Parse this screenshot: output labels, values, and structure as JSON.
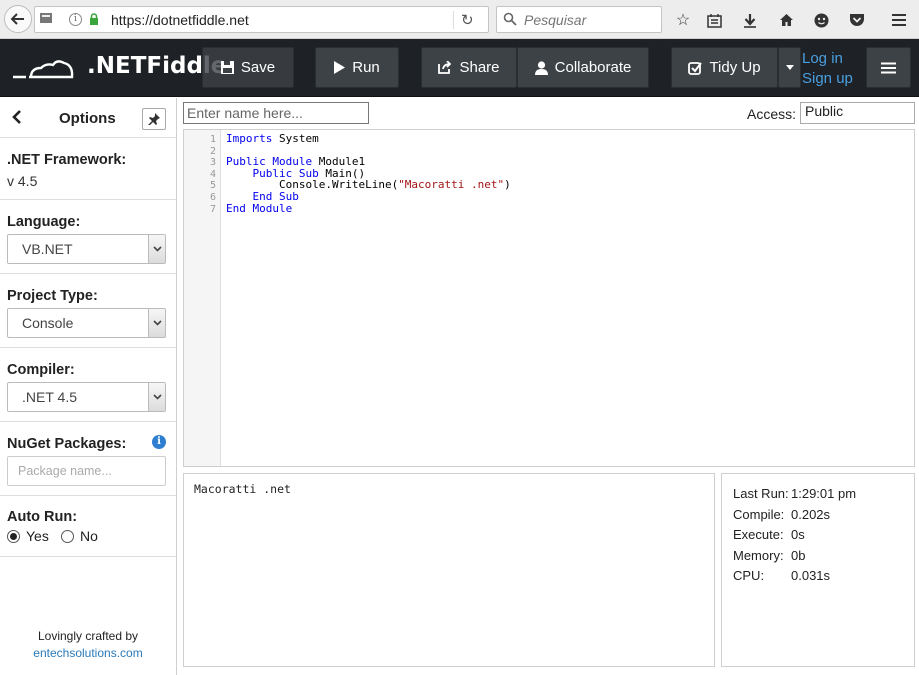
{
  "browser": {
    "url": "https://dotnetfiddle.net",
    "search_placeholder": "Pesquisar"
  },
  "header": {
    "logo_text": ".NETFiddle",
    "buttons": {
      "save": "Save",
      "run": "Run",
      "share": "Share",
      "collaborate": "Collaborate",
      "tidy_up": "Tidy Up"
    },
    "login": "Log in",
    "signup": "Sign up"
  },
  "sidebar": {
    "title": "Options",
    "framework_label": ".NET Framework:",
    "framework_value": "v 4.5",
    "language_label": "Language:",
    "language_value": "VB.NET",
    "project_type_label": "Project Type:",
    "project_type_value": "Console",
    "compiler_label": "Compiler:",
    "compiler_value": ".NET 4.5",
    "nuget_label": "NuGet Packages:",
    "nuget_placeholder": "Package name...",
    "autorun_label": "Auto Run:",
    "autorun_yes": "Yes",
    "autorun_no": "No",
    "credit_text": "Lovingly crafted by",
    "credit_link": "entechsolutions.com"
  },
  "main": {
    "name_placeholder": "Enter name here...",
    "access_label": "Access:",
    "access_value": "Public",
    "line_numbers": [
      "1",
      "2",
      "3",
      "4",
      "5",
      "6",
      "7"
    ],
    "code": {
      "l1_kw": "Imports",
      "l1_rest": " System",
      "l3_kw": "Public Module",
      "l3_rest": " Module1",
      "l4_indent": "    ",
      "l4_kw": "Public Sub",
      "l4_rest": " Main()",
      "l5_pre": "        Console.WriteLine(",
      "l5_str": "\"Macoratti .net\"",
      "l5_post": ")",
      "l6_indent": "    ",
      "l6_kw": "End Sub",
      "l7_kw": "End Module"
    },
    "output": "Macoratti .net",
    "stats": {
      "last_run_label": "Last Run:",
      "last_run": "1:29:01 pm",
      "compile_label": "Compile:",
      "compile": "0.202s",
      "execute_label": "Execute:",
      "execute": "0s",
      "memory_label": "Memory:",
      "memory": "0b",
      "cpu_label": "CPU:",
      "cpu": "0.031s"
    }
  }
}
